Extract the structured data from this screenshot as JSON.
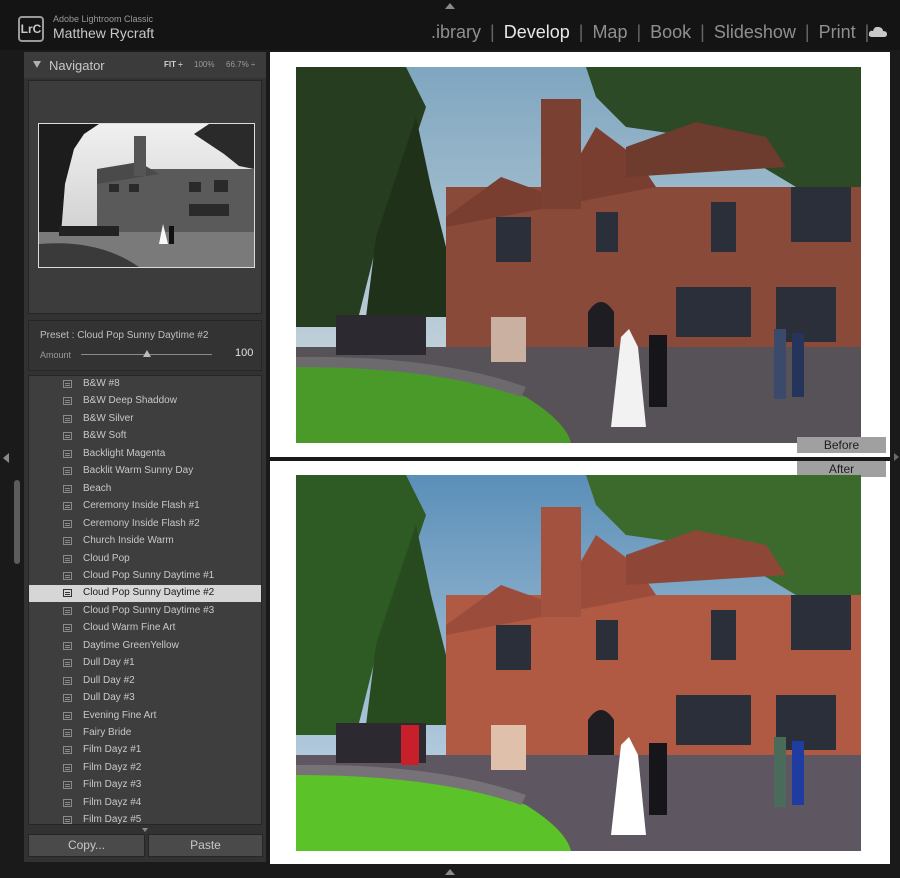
{
  "app": {
    "product_name": "Adobe Lightroom Classic",
    "logo_text": "LrC",
    "user_name": "Matthew Rycraft"
  },
  "modules": [
    {
      "label": ".ibrary",
      "active": false
    },
    {
      "label": "Develop",
      "active": true
    },
    {
      "label": "Map",
      "active": false
    },
    {
      "label": "Book",
      "active": false
    },
    {
      "label": "Slideshow",
      "active": false
    },
    {
      "label": "Print",
      "active": false
    }
  ],
  "navigator": {
    "title": "Navigator",
    "zoom_options": [
      "FIT ÷",
      "100%",
      "66.7% ÷"
    ]
  },
  "preset_panel": {
    "preset_label": "Preset : Cloud Pop Sunny Daytime #2",
    "amount_label": "Amount",
    "amount_value": "100",
    "amount_fraction": 1.0
  },
  "presets": [
    "B&W #8",
    "B&W Deep Shaddow",
    "B&W Silver",
    "B&W Soft",
    "Backlight Magenta",
    "Backlit Warm Sunny Day",
    "Beach",
    "Ceremony Inside Flash #1",
    "Ceremony Inside Flash #2",
    "Church Inside Warm",
    "Cloud Pop",
    "Cloud Pop Sunny Daytime #1",
    "Cloud Pop Sunny Daytime #2",
    "Cloud Pop Sunny Daytime #3",
    "Cloud Warm Fine Art",
    "Daytime GreenYellow",
    "Dull Day #1",
    "Dull Day #2",
    "Dull Day #3",
    "Evening Fine Art",
    "Fairy Bride",
    "Film Dayz #1",
    "Film Dayz #2",
    "Film Dayz #3",
    "Film Dayz #4",
    "Film Dayz #5"
  ],
  "selected_preset": "Cloud Pop Sunny Daytime #2",
  "buttons": {
    "copy": "Copy...",
    "paste": "Paste"
  },
  "compare": {
    "before_label": "Before",
    "after_label": "After"
  },
  "colors": {
    "accent_active": "#e8e8e8",
    "selected_row": "#d6d6d6"
  }
}
